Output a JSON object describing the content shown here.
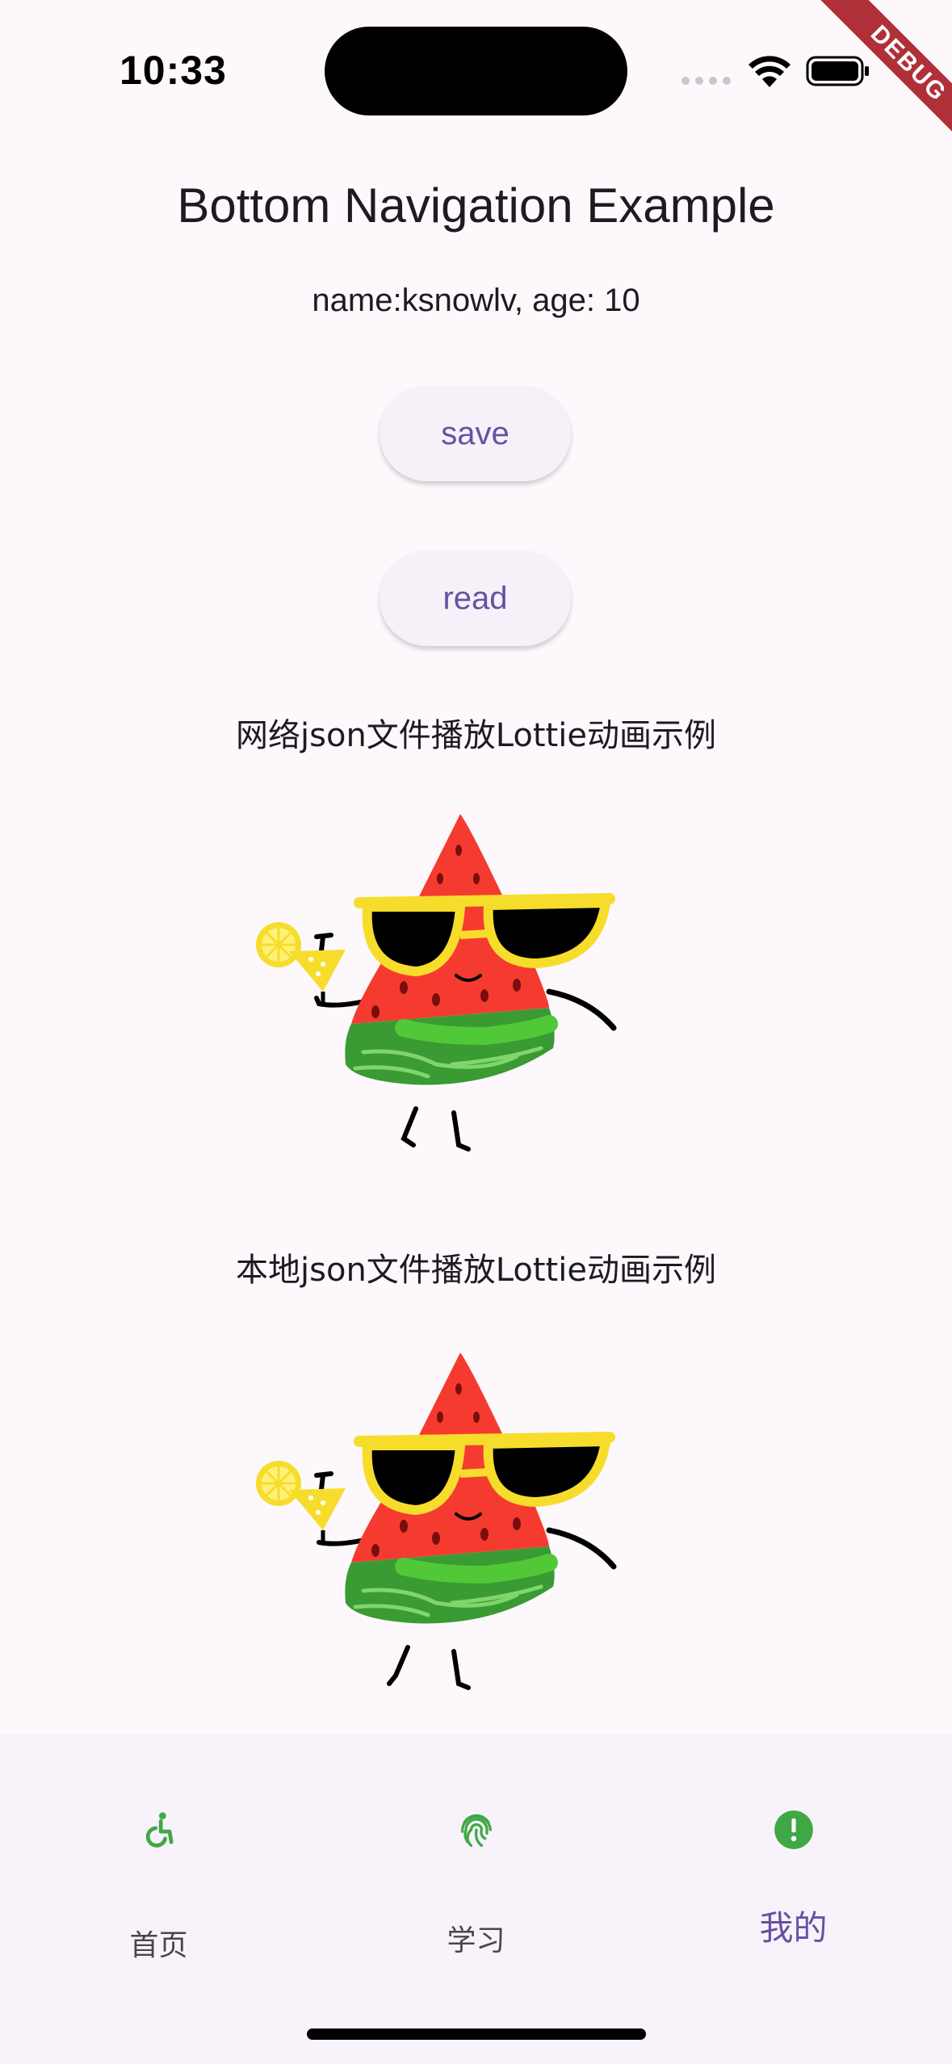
{
  "status_bar": {
    "time": "10:33"
  },
  "debug_banner": "DEBUG",
  "app_bar": {
    "title": "Bottom Navigation Example"
  },
  "user_info": "name:ksnowlv, age: 10",
  "buttons": {
    "save": "save",
    "read": "read"
  },
  "captions": {
    "network": "网络json文件播放Lottie动画示例",
    "local": "本地json文件播放Lottie动画示例"
  },
  "bottom_nav": {
    "items": [
      {
        "label": "首页",
        "icon": "accessible-icon"
      },
      {
        "label": "学习",
        "icon": "fingerprint-icon"
      },
      {
        "label": "我的",
        "icon": "error-icon",
        "selected": true
      }
    ],
    "colors": {
      "icon": "#3fa845",
      "selected_label": "#6750a4",
      "label": "#49454f"
    }
  },
  "colors": {
    "background": "#fdf8fc",
    "accent": "#6750a4"
  }
}
